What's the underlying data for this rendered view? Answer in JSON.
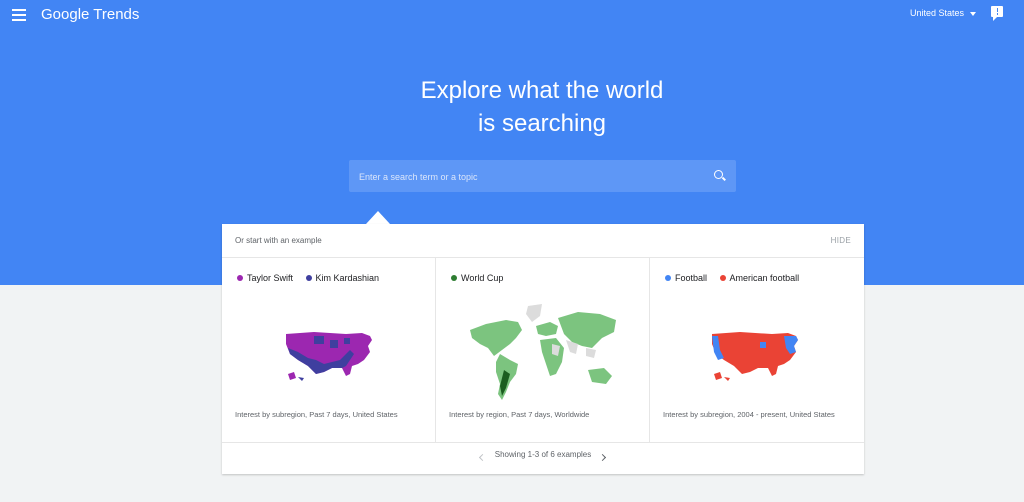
{
  "header": {
    "app_name": "Google Trends",
    "country": "United States"
  },
  "hero": {
    "line1": "Explore what the world",
    "line2": "is searching"
  },
  "search": {
    "placeholder": "Enter a search term or a topic"
  },
  "examples": {
    "title": "Or start with an example",
    "hide_label": "HIDE",
    "cards": [
      {
        "legend": [
          {
            "label": "Taylor Swift",
            "color": "#9c27b0"
          },
          {
            "label": "Kim Kardashian",
            "color": "#3f3f9f"
          }
        ],
        "caption": "Interest by subregion, Past 7 days, United States"
      },
      {
        "legend": [
          {
            "label": "World Cup",
            "color": "#4caf50"
          }
        ],
        "caption": "Interest by region, Past 7 days, Worldwide"
      },
      {
        "legend": [
          {
            "label": "Football",
            "color": "#4285f4"
          },
          {
            "label": "American football",
            "color": "#ea4335"
          }
        ],
        "caption": "Interest by subregion, 2004 - present, United States"
      }
    ],
    "pager_text": "Showing 1-3 of 6 examples"
  },
  "colors": {
    "hero_blue": "#4285f4",
    "search_bg": "#5e97f6",
    "page_bg": "#f1f3f4"
  }
}
